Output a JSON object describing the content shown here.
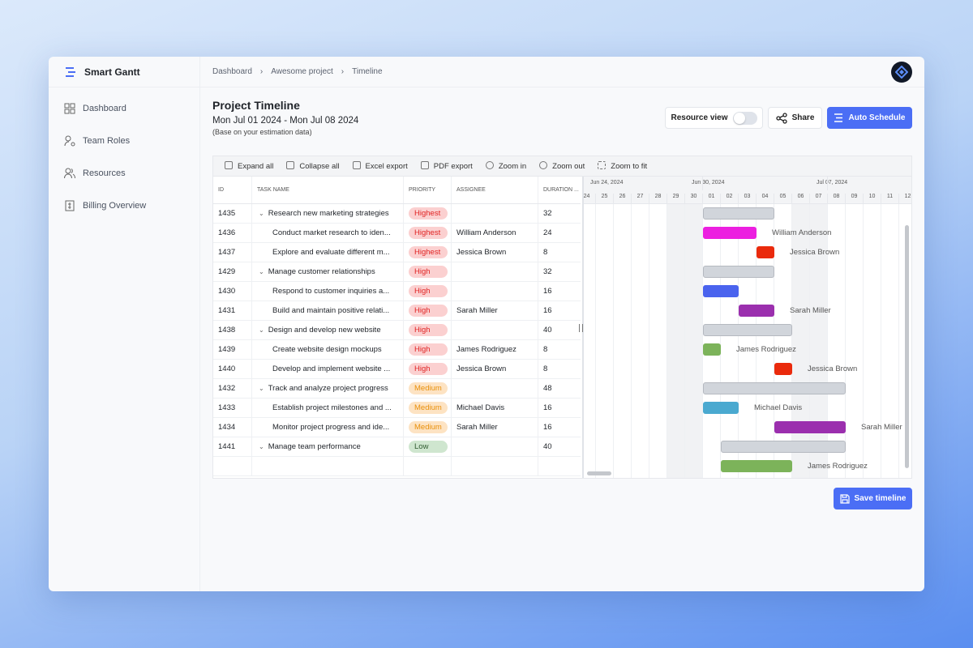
{
  "app": {
    "name": "Smart Gantt"
  },
  "sidebar": {
    "items": [
      {
        "label": "Dashboard",
        "icon": "grid-icon"
      },
      {
        "label": "Team Roles",
        "icon": "user-gear-icon"
      },
      {
        "label": "Resources",
        "icon": "users-icon"
      },
      {
        "label": "Billing Overview",
        "icon": "invoice-icon"
      }
    ]
  },
  "breadcrumb": [
    "Dashboard",
    "Awesome project",
    "Timeline"
  ],
  "header": {
    "title": "Project Timeline",
    "dates": "Mon Jul 01 2024 - Mon Jul 08 2024",
    "note": "(Base on your estimation data)",
    "resource_view": "Resource view",
    "resource_view_on": false,
    "share": "Share",
    "auto_schedule": "Auto Schedule"
  },
  "toolbar": [
    "Expand all",
    "Collapse all",
    "Excel export",
    "PDF export",
    "Zoom in",
    "Zoom out",
    "Zoom to fit"
  ],
  "columns": [
    "ID",
    "TASK NAME",
    "PRIORITY",
    "ASSIGNEE",
    "DURATION ..."
  ],
  "priority_colors": {
    "Highest": {
      "bg": "#fbd0d0",
      "fg": "#e02424"
    },
    "High": {
      "bg": "#fbd0d0",
      "fg": "#e02424"
    },
    "Medium": {
      "bg": "#fde3c3",
      "fg": "#e8900c"
    },
    "Low": {
      "bg": "#cfe6cf",
      "fg": "#2f5a2f"
    }
  },
  "rows": [
    {
      "id": "1435",
      "name": "Research new marketing strategies",
      "parent": true,
      "priority": "Highest",
      "assignee": "",
      "duration": "32",
      "start": "01",
      "end": "04",
      "color": "#d1d5db"
    },
    {
      "id": "1436",
      "name": "Conduct market research to iden...",
      "parent": false,
      "priority": "Highest",
      "assignee": "William Anderson",
      "duration": "24",
      "start": "01",
      "end": "03",
      "color": "#ec1fe0"
    },
    {
      "id": "1437",
      "name": "Explore and evaluate different m...",
      "parent": false,
      "priority": "Highest",
      "assignee": "Jessica Brown",
      "duration": "8",
      "start": "04",
      "end": "04",
      "color": "#ea2a0c"
    },
    {
      "id": "1429",
      "name": "Manage customer relationships",
      "parent": true,
      "priority": "High",
      "assignee": "",
      "duration": "32",
      "start": "01",
      "end": "04",
      "color": "#d1d5db"
    },
    {
      "id": "1430",
      "name": "Respond to customer inquiries a...",
      "parent": false,
      "priority": "High",
      "assignee": "",
      "duration": "16",
      "start": "01",
      "end": "02",
      "color": "#4a63ee"
    },
    {
      "id": "1431",
      "name": "Build and maintain positive relati...",
      "parent": false,
      "priority": "High",
      "assignee": "Sarah Miller",
      "duration": "16",
      "start": "03",
      "end": "04",
      "color": "#9b2fae"
    },
    {
      "id": "1438",
      "name": "Design and develop new website",
      "parent": true,
      "priority": "High",
      "assignee": "",
      "duration": "40",
      "start": "01",
      "end": "05",
      "color": "#d1d5db"
    },
    {
      "id": "1439",
      "name": "Create website design mockups",
      "parent": false,
      "priority": "High",
      "assignee": "James Rodriguez",
      "duration": "8",
      "start": "01",
      "end": "01",
      "color": "#7cb35a"
    },
    {
      "id": "1440",
      "name": "Develop and implement website ...",
      "parent": false,
      "priority": "High",
      "assignee": "Jessica Brown",
      "duration": "8",
      "start": "05",
      "end": "05",
      "color": "#ea2a0c"
    },
    {
      "id": "1432",
      "name": "Track and analyze project progress",
      "parent": true,
      "priority": "Medium",
      "assignee": "",
      "duration": "48",
      "start": "01",
      "end": "08",
      "color": "#d1d5db"
    },
    {
      "id": "1433",
      "name": "Establish project milestones and ...",
      "parent": false,
      "priority": "Medium",
      "assignee": "Michael Davis",
      "duration": "16",
      "start": "01",
      "end": "02",
      "color": "#4aa9d0"
    },
    {
      "id": "1434",
      "name": "Monitor project progress and ide...",
      "parent": false,
      "priority": "Medium",
      "assignee": "Sarah Miller",
      "duration": "16",
      "start": "05",
      "end": "08",
      "color": "#9b2fae"
    },
    {
      "id": "1441",
      "name": "Manage team performance",
      "parent": true,
      "priority": "Low",
      "assignee": "",
      "duration": "40",
      "start": "02",
      "end": "08",
      "color": "#d1d5db"
    },
    {
      "id": "",
      "name": "",
      "parent": false,
      "priority": "",
      "assignee": "James Rodriguez",
      "duration": "",
      "start": "02",
      "end": "05",
      "color": "#7cb35a"
    }
  ],
  "timeline": {
    "weeks": [
      "Jun 24, 2024",
      "Jun 30, 2024",
      "Jul 07, 2024"
    ],
    "days": [
      "24",
      "25",
      "26",
      "27",
      "28",
      "29",
      "30",
      "01",
      "02",
      "03",
      "04",
      "05",
      "06",
      "07",
      "08",
      "09",
      "10",
      "11",
      "12"
    ],
    "weekend": [
      "29",
      "30",
      "06",
      "07"
    ]
  },
  "save": "Save timeline"
}
